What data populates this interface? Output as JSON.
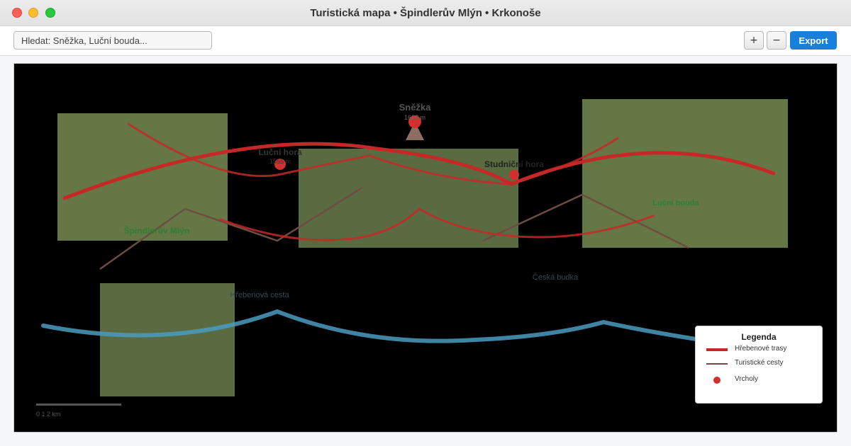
{
  "window": {
    "title": "Turistická mapa • Špindlerův Mlýn • Krkonoše"
  },
  "toolbar": {
    "search_placeholder": "Hledat: Sněžka, Luční bouda...",
    "search_value": "",
    "zoom_in_label": "+",
    "zoom_out_label": "−",
    "export_label": "Export",
    "export_color": "#1a7fd8"
  },
  "map": {
    "background": "#000000",
    "forest_color": "#6b7d4a",
    "ridge_color": "#c62828",
    "path_color": "#6d4c41",
    "river_color": "#4a9bbf",
    "peaks": [
      {
        "name": "Sněžka",
        "elevation": "1603 m"
      },
      {
        "name": "Luční hora",
        "elevation": "1555 m"
      },
      {
        "name": "Studniční hora",
        "elevation": ""
      }
    ],
    "places": [
      {
        "name": "Špindlerův Mlýn"
      },
      {
        "name": "Luční bouda"
      },
      {
        "name": "Česká budka"
      },
      {
        "name": "Hřebenová cesta"
      }
    ],
    "scale_label": "0 1 2 km"
  },
  "legend": {
    "title": "Legenda",
    "ridge_label": "Hřebenové trasy",
    "path_label": "Turistické cesty",
    "peak_label": "Vrcholy"
  }
}
